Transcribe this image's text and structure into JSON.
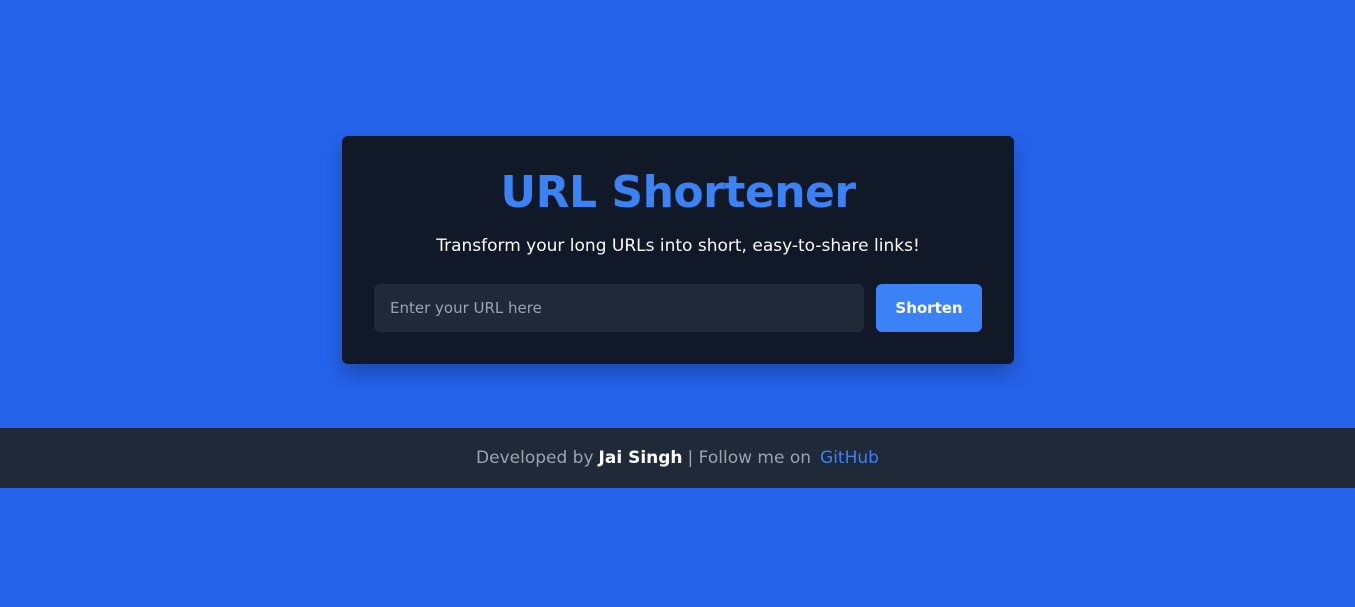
{
  "app": {
    "title": "URL Shortener",
    "subtitle": "Transform your long URLs into short, easy-to-share links!"
  },
  "form": {
    "url_value": "",
    "url_placeholder": "Enter your URL here",
    "submit_label": "Shorten"
  },
  "footer": {
    "developed_by": "Developed by",
    "author": "Jai Singh",
    "follow_text": "| Follow me on",
    "github_label": "GitHub"
  },
  "colors": {
    "background": "#2563eb",
    "card": "#111827",
    "accent": "#3b82f6",
    "footer": "#1f2937"
  }
}
